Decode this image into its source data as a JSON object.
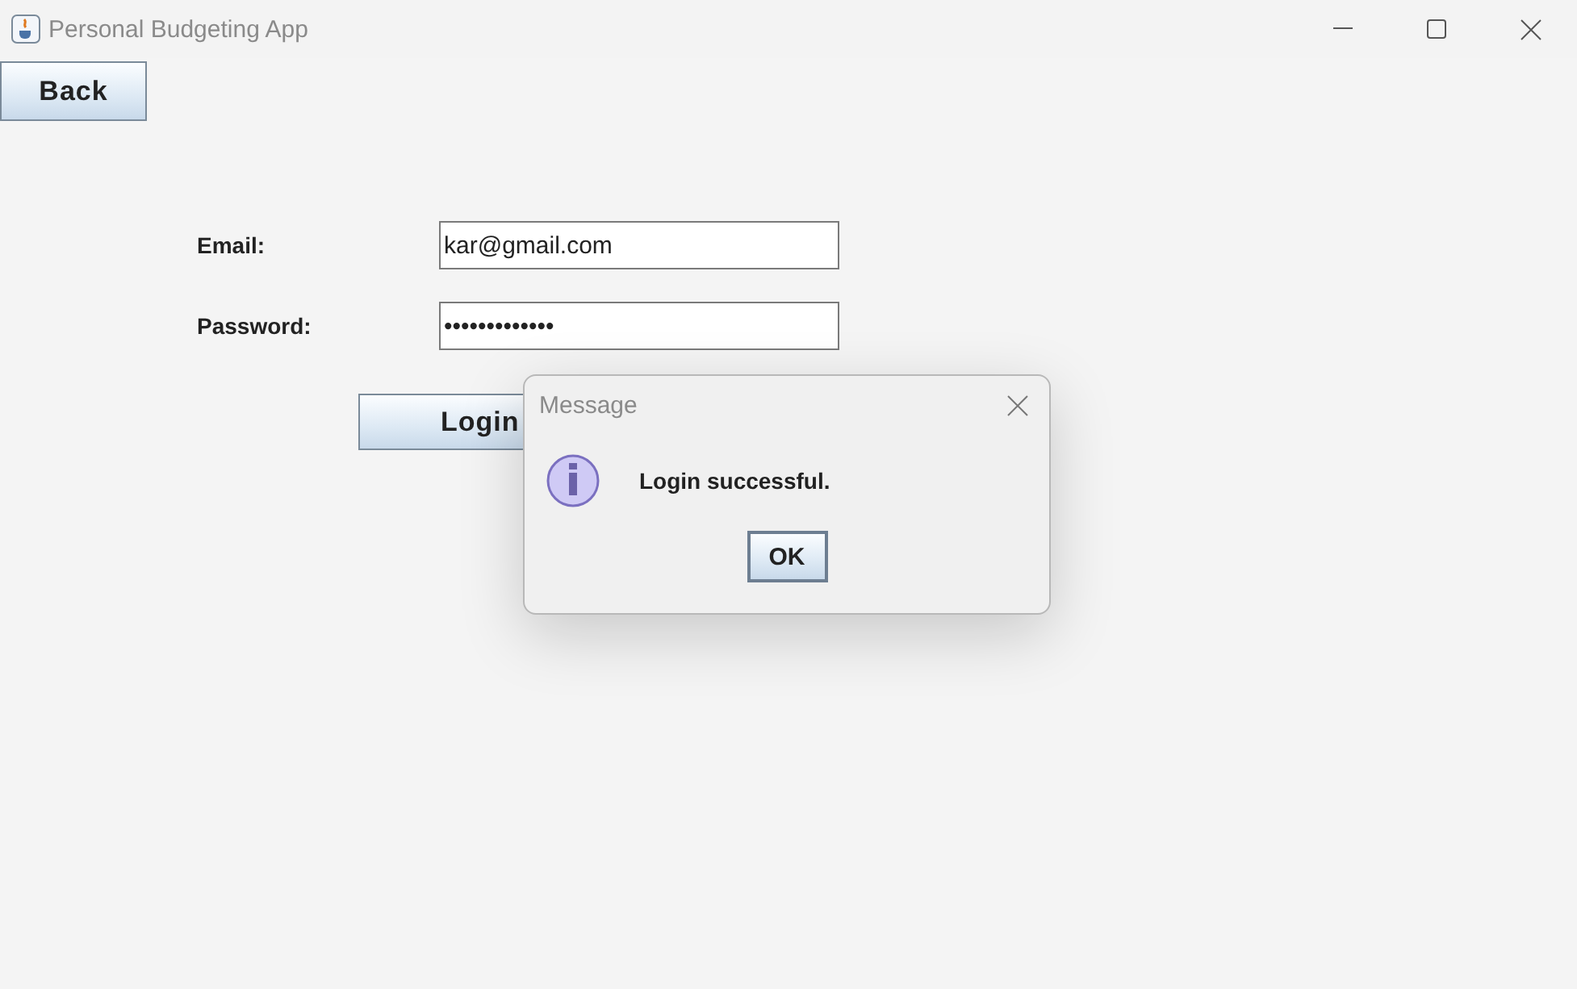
{
  "window": {
    "title": "Personal Budgeting App"
  },
  "back_button": "Back",
  "form": {
    "email": {
      "label": "Email:",
      "value": "kar@gmail.com"
    },
    "password": {
      "label": "Password:",
      "value": "•••••••••••••"
    },
    "login_button": "Login"
  },
  "dialog": {
    "title": "Message",
    "message": "Login successful.",
    "ok_button": "OK"
  }
}
